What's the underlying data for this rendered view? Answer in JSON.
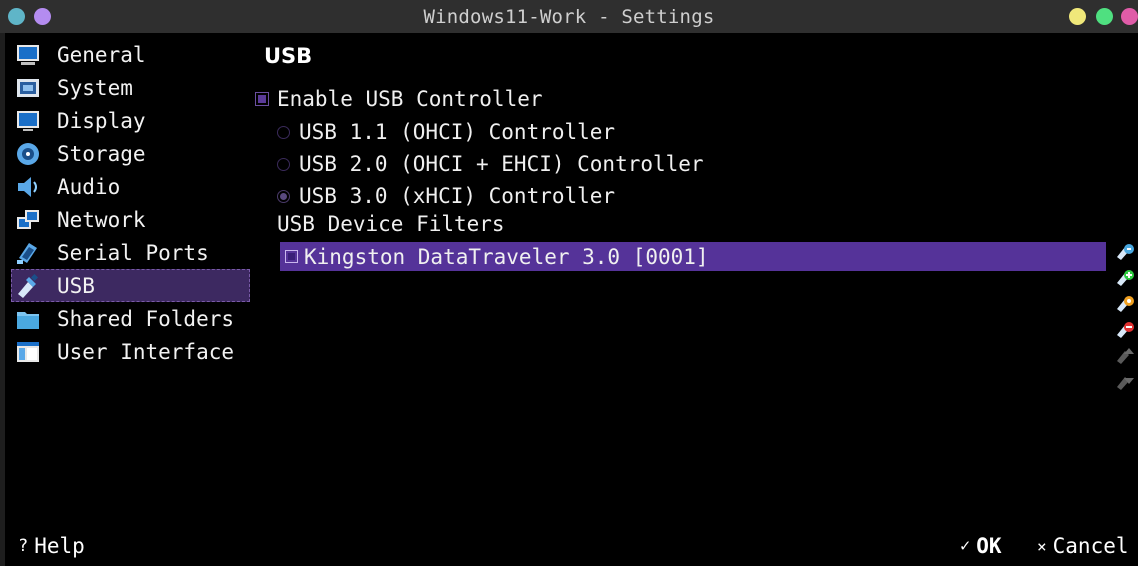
{
  "window": {
    "title": "Windows11-Work - Settings",
    "buttons": {
      "left": [
        "#5fb5c8",
        "#b48cf0"
      ],
      "right": [
        "#f0e87a",
        "#4fe080",
        "#e05ca8"
      ]
    }
  },
  "sidebar": {
    "items": [
      {
        "label": "General",
        "icon": "monitor-icon"
      },
      {
        "label": "System",
        "icon": "chip-icon"
      },
      {
        "label": "Display",
        "icon": "display-icon"
      },
      {
        "label": "Storage",
        "icon": "disk-icon"
      },
      {
        "label": "Audio",
        "icon": "speaker-icon"
      },
      {
        "label": "Network",
        "icon": "network-icon"
      },
      {
        "label": "Serial Ports",
        "icon": "serial-port-icon"
      },
      {
        "label": "USB",
        "icon": "usb-icon",
        "selected": true
      },
      {
        "label": "Shared Folders",
        "icon": "folder-icon"
      },
      {
        "label": "User Interface",
        "icon": "window-icon"
      }
    ]
  },
  "main": {
    "title": "USB",
    "enable_usb": {
      "label": "Enable USB Controller",
      "checked": true
    },
    "controllers": [
      {
        "label": "USB 1.1 (OHCI) Controller",
        "checked": false
      },
      {
        "label": "USB 2.0 (OHCI + EHCI) Controller",
        "checked": false
      },
      {
        "label": "USB 3.0 (xHCI) Controller",
        "checked": true
      }
    ],
    "filters_label": "USB Device Filters",
    "filters": [
      {
        "label": "Kingston DataTraveler 3.0 [0001]",
        "checked": true
      }
    ],
    "tools": [
      "add-empty-filter-icon",
      "add-device-filter-icon",
      "edit-filter-icon",
      "remove-filter-icon",
      "move-up-icon",
      "move-down-icon"
    ]
  },
  "footer": {
    "help": {
      "glyph": "?",
      "label": "Help"
    },
    "ok": {
      "glyph": "✓",
      "label": "OK"
    },
    "cancel": {
      "glyph": "×",
      "label": "Cancel"
    }
  },
  "colors": {
    "accent": "#553399",
    "selected_sidebar": "#3d2961",
    "background": "#000000",
    "titlebar": "#2f2f2f"
  }
}
